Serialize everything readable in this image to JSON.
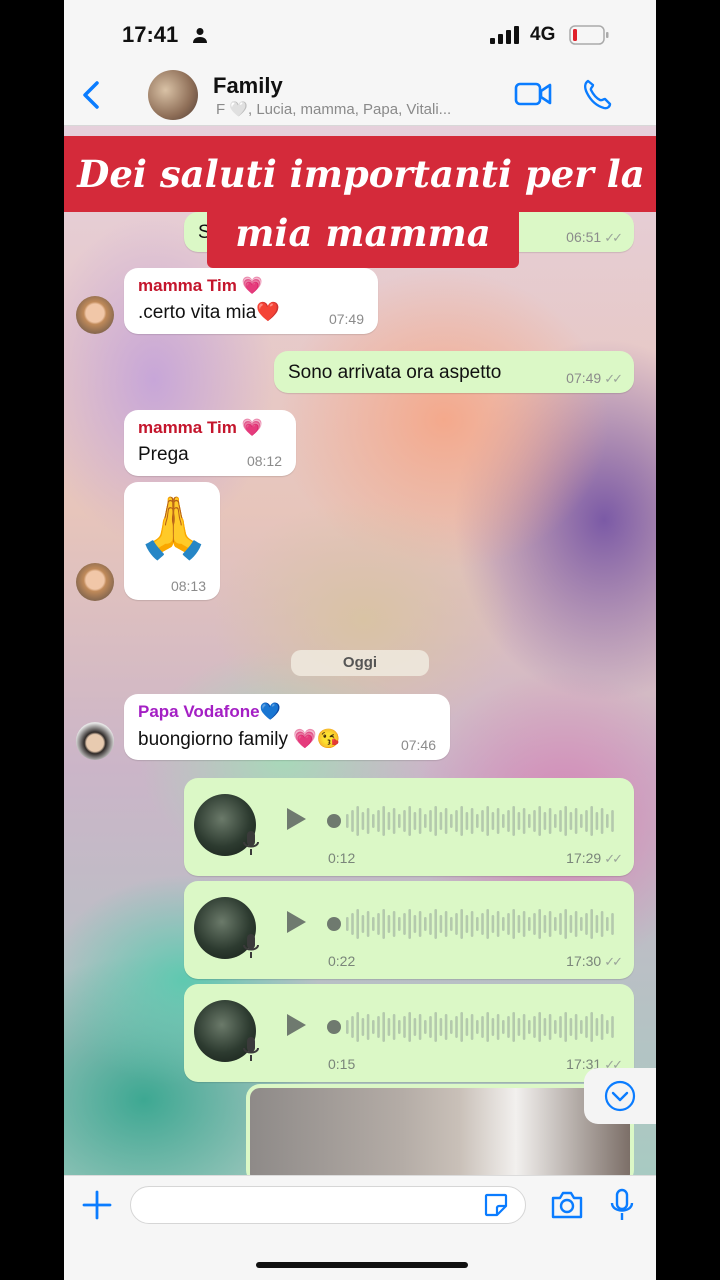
{
  "status_bar": {
    "time": "17:41",
    "network": "4G"
  },
  "header": {
    "title": "Family",
    "subtitle": "F 🤍, Lucia, mamma, Papa, Vitali..."
  },
  "banner": {
    "line1": "Dei saluti importanti per la",
    "line2": "mia mamma"
  },
  "messages": [
    {
      "type": "out",
      "partial_text": "S",
      "time": "06:51"
    },
    {
      "type": "in",
      "sender": "mamma Tim 💗",
      "text": ".certo vita mia❤️",
      "time": "07:49"
    },
    {
      "type": "out",
      "text": "Sono arrivata ora aspetto",
      "time": "07:49"
    },
    {
      "type": "in",
      "sender": "mamma Tim 💗",
      "text": "Prega",
      "time": "08:12"
    },
    {
      "type": "in",
      "text": "🙏",
      "time": "08:13"
    },
    {
      "type": "in",
      "sender": "Papa Vodafone💙",
      "text": "buongiorno family 💗😘",
      "time": "07:46"
    }
  ],
  "date_divider": "Oggi",
  "voice_messages": [
    {
      "duration": "0:12",
      "time": "17:29"
    },
    {
      "duration": "0:22",
      "time": "17:30"
    },
    {
      "duration": "0:15",
      "time": "17:31"
    }
  ],
  "colors": {
    "banner": "#d42a3a",
    "outgoing_bubble": "#dbf8c6",
    "accent": "#0a7cff",
    "mamma_name": "#c4152c",
    "papa_name": "#a41fc4"
  },
  "icons": [
    "back-icon",
    "video-call-icon",
    "phone-call-icon",
    "play-icon",
    "microphone-icon",
    "plus-icon",
    "sticker-icon",
    "camera-icon",
    "scroll-down-icon"
  ]
}
